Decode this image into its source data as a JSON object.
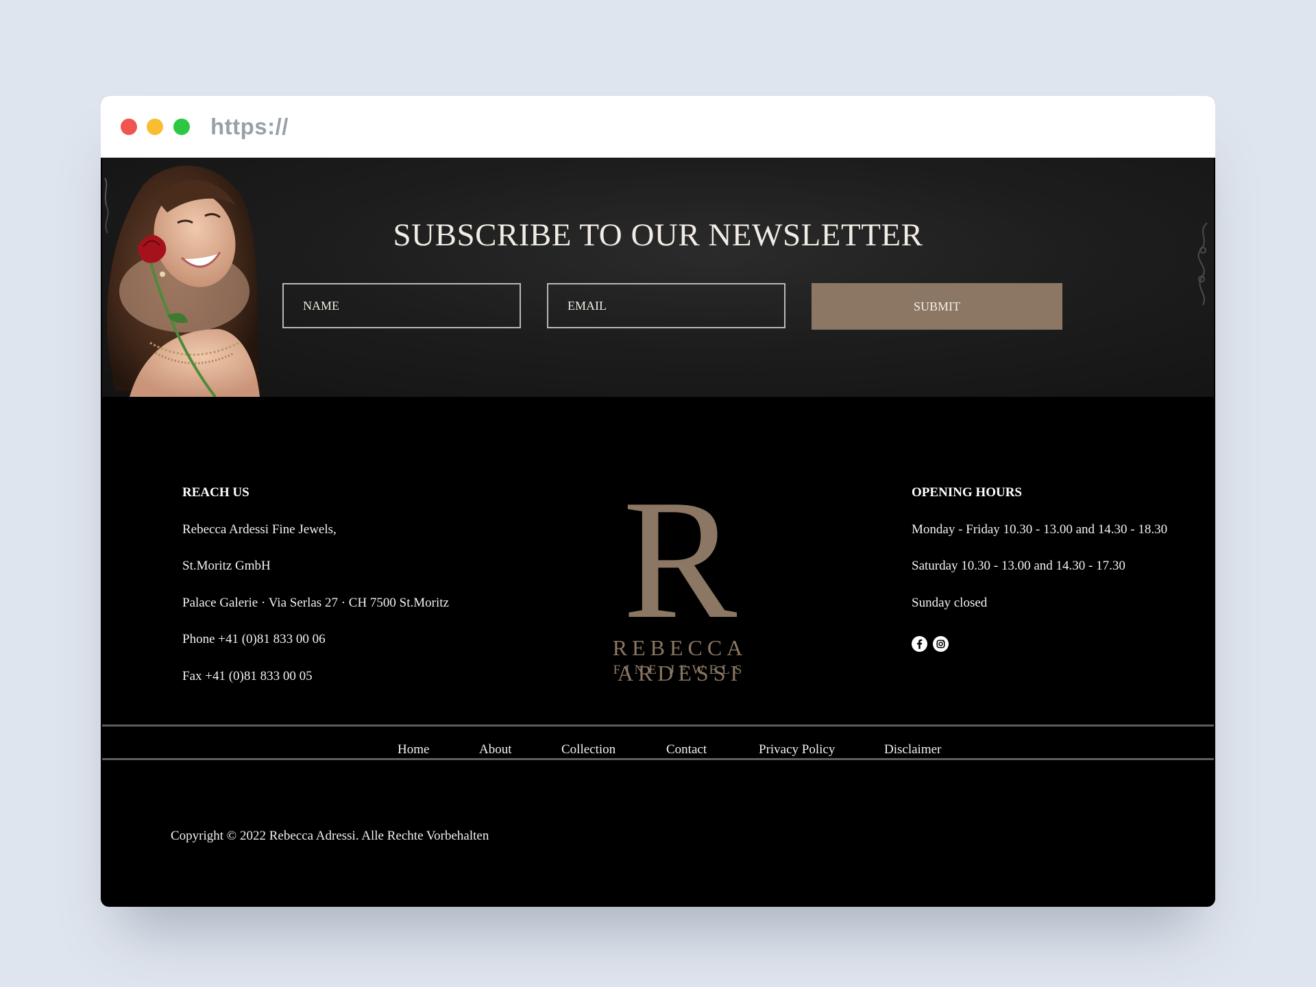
{
  "browser": {
    "url": "https://",
    "colors": {
      "close": "#f0554f",
      "minimize": "#f8bd31",
      "maximize": "#2cc842"
    }
  },
  "newsletter": {
    "title": "SUBSCRIBE TO OUR NEWSLETTER",
    "name_placeholder": "NAME",
    "email_placeholder": "EMAIL",
    "submit_label": "SUBMIT",
    "accent_color": "#8b7763"
  },
  "reach_us": {
    "heading": "REACH US",
    "lines": [
      "Rebecca Ardessi Fine Jewels,",
      "St.Moritz GmbH",
      "Palace Galerie · Via Serlas 27 · CH 7500 St.Moritz",
      "Phone +41 (0)81 833 00 06",
      "Fax +41 (0)81 833 00 05"
    ]
  },
  "logo": {
    "monogram": "R",
    "name": "REBECCA ARDESSI",
    "tagline": "FINE JEWELS",
    "color": "#8b7763"
  },
  "opening_hours": {
    "heading": "OPENING HOURS",
    "lines": [
      "Monday - Friday 10.30 - 13.00 and 14.30 - 18.30",
      "Saturday 10.30 - 13.00 and 14.30 - 17.30",
      "Sunday closed"
    ],
    "social_icons": [
      "facebook-icon",
      "instagram-icon"
    ]
  },
  "nav": {
    "items": [
      "Home",
      "About",
      "Collection",
      "Contact",
      "Privacy Policy",
      "Disclaimer"
    ]
  },
  "copyright": "Copyright © 2022 Rebecca Adressi. Alle Rechte Vorbehalten"
}
